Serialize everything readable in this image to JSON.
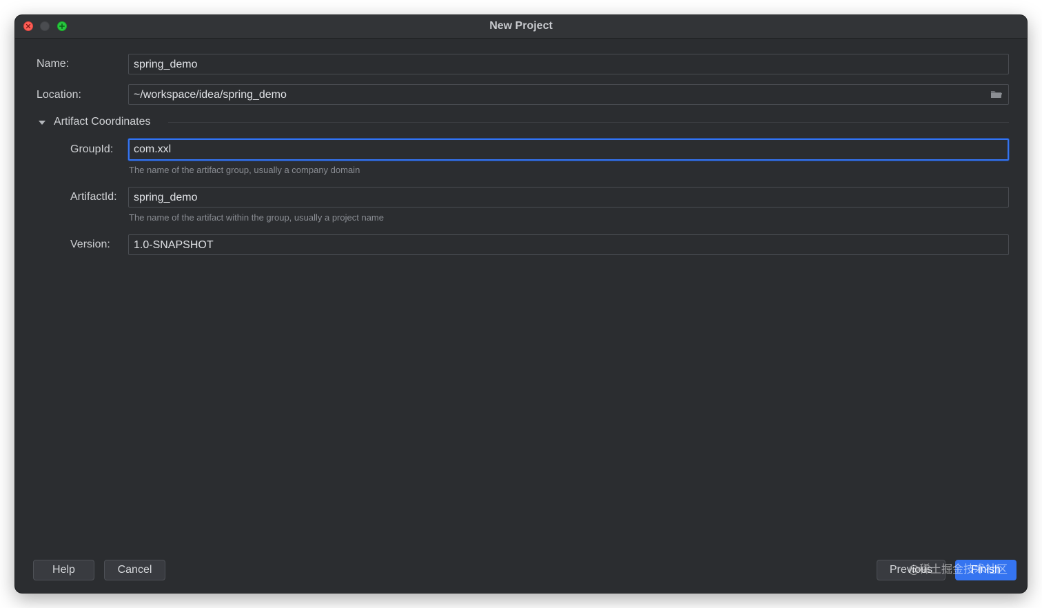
{
  "window": {
    "title": "New Project"
  },
  "form": {
    "name": {
      "label": "Name:",
      "value": "spring_demo"
    },
    "location": {
      "label": "Location:",
      "value": "~/workspace/idea/spring_demo"
    },
    "artifact_section": {
      "title": "Artifact Coordinates",
      "expanded": true,
      "group_id": {
        "label": "GroupId:",
        "value": "com.xxl",
        "hint": "The name of the artifact group, usually a company domain"
      },
      "artifact_id": {
        "label": "ArtifactId:",
        "value": "spring_demo",
        "hint": "The name of the artifact within the group, usually a project name"
      },
      "version": {
        "label": "Version:",
        "value": "1.0-SNAPSHOT"
      }
    }
  },
  "buttons": {
    "help": "Help",
    "cancel": "Cancel",
    "previous": "Previous",
    "finish": "Finish"
  },
  "watermark": "@稀土掘金技术社区",
  "icons": {
    "close": "close-icon",
    "minimize": "minimize-icon",
    "zoom": "zoom-icon",
    "folder": "folder-icon",
    "chevron": "chevron-down-icon"
  },
  "colors": {
    "background": "#2b2d30",
    "accent": "#3574f0",
    "text": "#dfe1e5",
    "hint": "#8a8d93"
  }
}
